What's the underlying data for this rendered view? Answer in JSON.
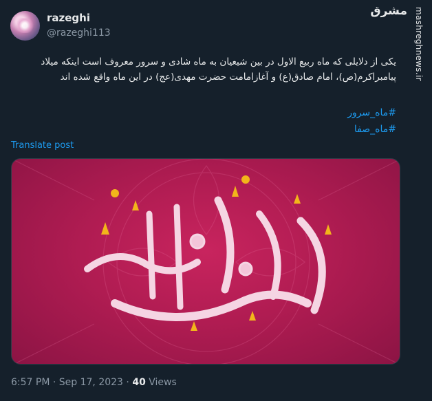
{
  "tweet": {
    "display_name": "razeghi",
    "handle": "@razeghi113",
    "text": "یکی از دلایلی که ماه ربیع الاول در بین شیعیان به ماه شادی و سرور معروف است اینکه میلاد پیامبراکرم(ص)، امام صادق(ع) و آغازامامت حضرت مهدی(عج) در این ماه واقع شده اند",
    "hashtags": [
      "#ماه_سرور",
      "#ماه_صفا"
    ],
    "translate_label": "Translate post",
    "time": "6:57 PM",
    "separator": "·",
    "date": "Sep 17, 2023",
    "views_count": "40",
    "views_label": "Views"
  },
  "watermark": {
    "logo": "مشرق",
    "site": "mashreghnews.ir"
  },
  "colors": {
    "background": "#15202b",
    "link": "#1d9bf0",
    "muted": "#8b98a5",
    "image_magenta": "#b01c52"
  }
}
